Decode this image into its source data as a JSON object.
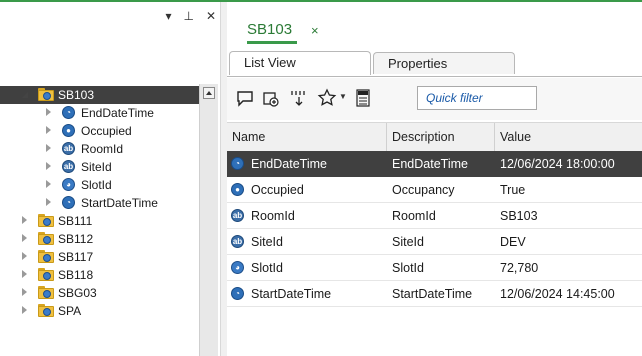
{
  "panel": {
    "dropdown_glyph": "▾",
    "pin_glyph": "⊥",
    "close_glyph": "✕"
  },
  "tree": {
    "items": [
      {
        "label": "SB103",
        "kind": "folder",
        "expanded": true,
        "selected": true,
        "level": 0
      },
      {
        "label": "EndDateTime",
        "kind": "datetime-property",
        "level": 1
      },
      {
        "label": "Occupied",
        "kind": "boolean-property",
        "level": 1
      },
      {
        "label": "RoomId",
        "kind": "string-property",
        "level": 1
      },
      {
        "label": "SiteId",
        "kind": "string-property",
        "level": 1
      },
      {
        "label": "SlotId",
        "kind": "number-property",
        "level": 1
      },
      {
        "label": "StartDateTime",
        "kind": "datetime-property",
        "level": 1
      },
      {
        "label": "SB111",
        "kind": "folder",
        "level": 0
      },
      {
        "label": "SB112",
        "kind": "folder",
        "level": 0
      },
      {
        "label": "SB117",
        "kind": "folder",
        "level": 0
      },
      {
        "label": "SB118",
        "kind": "folder",
        "level": 0
      },
      {
        "label": "SBG03",
        "kind": "folder",
        "level": 0
      },
      {
        "label": "SPA",
        "kind": "folder",
        "level": 0
      }
    ]
  },
  "document": {
    "tab_title": "SB103",
    "tab_close": "×",
    "sub_tabs": [
      {
        "label": "List View",
        "active": true
      },
      {
        "label": "Properties",
        "active": false
      }
    ],
    "toolbar": {
      "quick_filter_placeholder": "Quick filter",
      "icons": [
        "chat-icon",
        "new-item-icon",
        "column-chooser-icon",
        "puzzle-icon",
        "export-xlsx-icon"
      ]
    },
    "grid": {
      "columns": [
        "Name",
        "Description",
        "Value"
      ],
      "rows": [
        {
          "name": "EndDateTime",
          "description": "EndDateTime",
          "value": "12/06/2024 18:00:00",
          "icon": "datetime-icon",
          "selected": true
        },
        {
          "name": "Occupied",
          "description": "Occupancy",
          "value": "True",
          "icon": "boolean-icon"
        },
        {
          "name": "RoomId",
          "description": "RoomId",
          "value": "SB103",
          "icon": "string-icon"
        },
        {
          "name": "SiteId",
          "description": "SiteId",
          "value": "DEV",
          "icon": "string-icon"
        },
        {
          "name": "SlotId",
          "description": "SlotId",
          "value": "72,780",
          "icon": "number-icon"
        },
        {
          "name": "StartDateTime",
          "description": "StartDateTime",
          "value": "12/06/2024 14:45:00",
          "icon": "datetime-icon"
        }
      ]
    }
  },
  "colors": {
    "accent": "#3a9a4a",
    "selection": "#404040",
    "folder": "#f0c040"
  }
}
